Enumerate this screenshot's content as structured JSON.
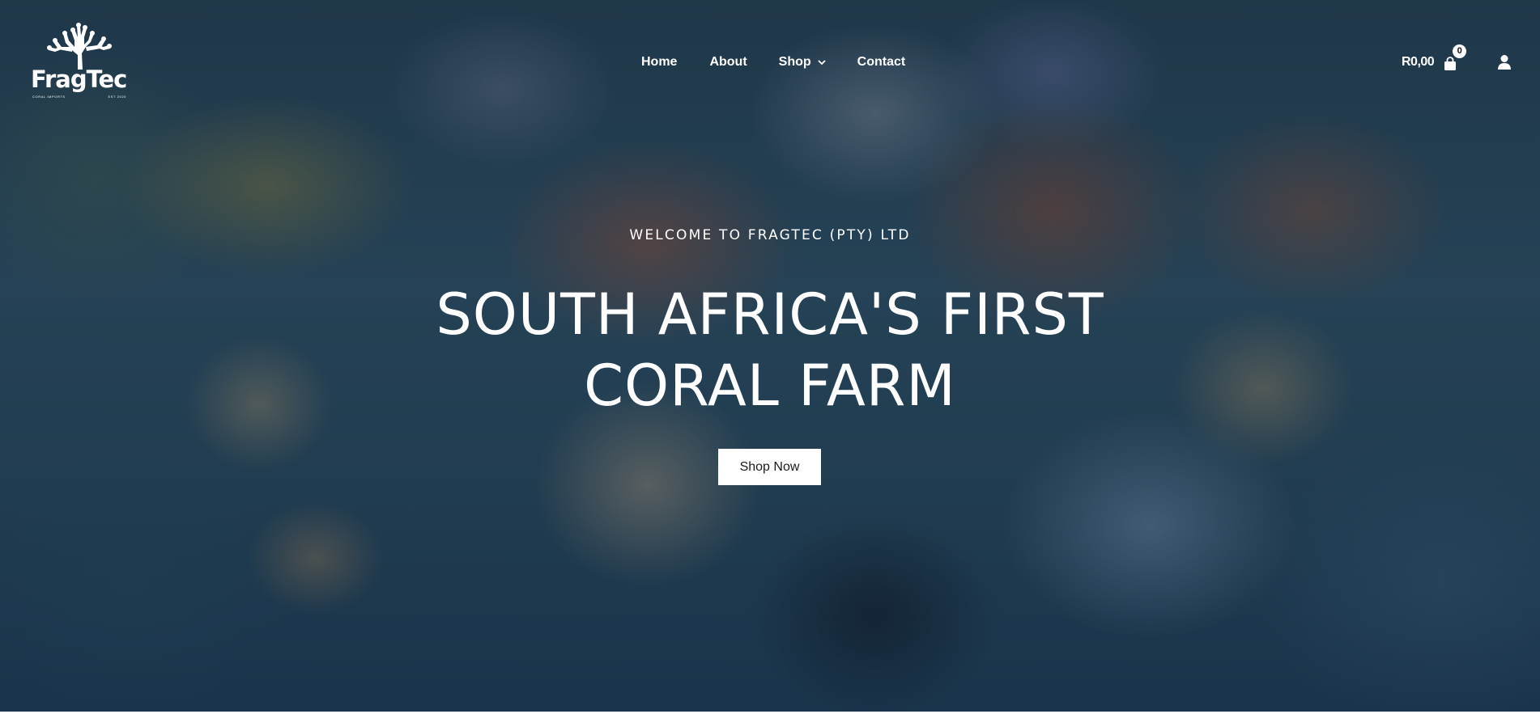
{
  "brand": {
    "name": "FragTec",
    "tagline_left": "CORAL IMPORTS",
    "tagline_right": "EST 2020",
    "icon": "coral-logo-icon"
  },
  "nav": {
    "items": [
      {
        "label": "Home"
      },
      {
        "label": "About"
      },
      {
        "label": "Shop",
        "icon": "chevron-down-icon"
      },
      {
        "label": "Contact"
      }
    ]
  },
  "cart": {
    "total": "R0,00",
    "count": "0",
    "icon": "shopping-bag-icon"
  },
  "account": {
    "icon": "user-icon"
  },
  "hero": {
    "eyebrow": "WELCOME TO FRAGTEC (PTY) LTD",
    "headline_line1": "SOUTH AFRICA'S FIRST",
    "headline_line2": "CORAL FARM",
    "cta_label": "Shop Now"
  },
  "colors": {
    "text": "#ffffff",
    "button_bg": "#ffffff",
    "button_text": "#1a1a1a",
    "overlay": "#0a192d"
  }
}
